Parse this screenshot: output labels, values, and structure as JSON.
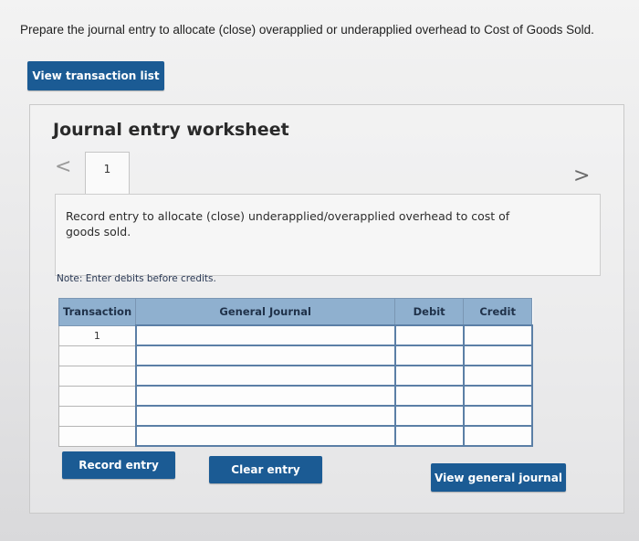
{
  "instruction": "Prepare the journal entry to allocate (close) overapplied or underapplied overhead to Cost of Goods Sold.",
  "buttons": {
    "view_transaction_list": "View transaction list",
    "record_entry": "Record entry",
    "clear_entry": "Clear entry",
    "view_general_journal": "View general journal"
  },
  "worksheet": {
    "title": "Journal entry worksheet",
    "nav_prev": "<",
    "nav_next": ">",
    "active_tab": "1",
    "entry_description": "Record entry to allocate (close) underapplied/overapplied overhead to cost of goods sold.",
    "note": "Note: Enter debits before credits."
  },
  "journal_table": {
    "headers": {
      "transaction": "Transaction",
      "general_journal": "General Journal",
      "debit": "Debit",
      "credit": "Credit"
    },
    "rows": [
      {
        "transaction": "1",
        "account": "",
        "debit": "",
        "credit": ""
      },
      {
        "transaction": "",
        "account": "",
        "debit": "",
        "credit": ""
      },
      {
        "transaction": "",
        "account": "",
        "debit": "",
        "credit": ""
      },
      {
        "transaction": "",
        "account": "",
        "debit": "",
        "credit": ""
      },
      {
        "transaction": "",
        "account": "",
        "debit": "",
        "credit": ""
      },
      {
        "transaction": "",
        "account": "",
        "debit": "",
        "credit": ""
      }
    ]
  },
  "colors": {
    "button_blue": "#1b5b94",
    "table_header": "#8fb0cf",
    "input_border": "#5b7fa6"
  }
}
